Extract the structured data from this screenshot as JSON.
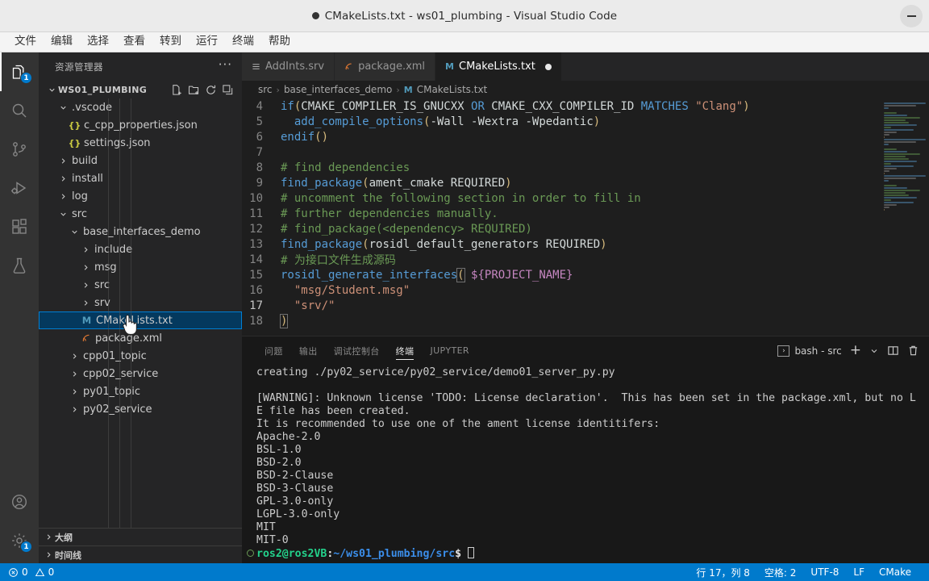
{
  "window": {
    "title": "CMakeLists.txt - ws01_plumbing - Visual Studio Code",
    "dirty_indicator": "●",
    "minimize_label": "–"
  },
  "menubar": {
    "items": [
      {
        "label": "文件",
        "name": "menu-file"
      },
      {
        "label": "编辑",
        "name": "menu-edit"
      },
      {
        "label": "选择",
        "name": "menu-selection"
      },
      {
        "label": "查看",
        "name": "menu-view"
      },
      {
        "label": "转到",
        "name": "menu-go"
      },
      {
        "label": "运行",
        "name": "menu-run"
      },
      {
        "label": "终端",
        "name": "menu-terminal"
      },
      {
        "label": "帮助",
        "name": "menu-help"
      }
    ]
  },
  "activitybar": {
    "items": [
      {
        "icon": "files-explorer-icon",
        "active": true,
        "badge": "1"
      },
      {
        "icon": "search-icon",
        "active": false,
        "badge": ""
      },
      {
        "icon": "source-control-icon",
        "active": false,
        "badge": ""
      },
      {
        "icon": "run-and-debug-icon",
        "active": false,
        "badge": ""
      },
      {
        "icon": "extensions-icon",
        "active": false,
        "badge": ""
      },
      {
        "icon": "testing-flask-icon",
        "active": false,
        "badge": ""
      }
    ],
    "bottom": [
      {
        "icon": "account-icon",
        "badge": ""
      },
      {
        "icon": "settings-gear-icon",
        "badge": "1"
      }
    ]
  },
  "sidebar": {
    "title": "资源管理器",
    "more_actions": "···",
    "root": {
      "label": "WS01_PLUMBING",
      "actions": [
        "new-file-icon",
        "new-folder-icon",
        "refresh-icon",
        "collapse-all-icon"
      ]
    },
    "tree": [
      {
        "label": ".vscode",
        "depth": 1,
        "type": "folder",
        "expanded": true,
        "icon": "chevron-down-icon"
      },
      {
        "label": "c_cpp_properties.json",
        "depth": 2,
        "type": "json",
        "icon": "json-file-icon"
      },
      {
        "label": "settings.json",
        "depth": 2,
        "type": "json",
        "icon": "json-file-icon"
      },
      {
        "label": "build",
        "depth": 1,
        "type": "folder",
        "expanded": false,
        "icon": "chevron-right-icon"
      },
      {
        "label": "install",
        "depth": 1,
        "type": "folder",
        "expanded": false,
        "icon": "chevron-right-icon"
      },
      {
        "label": "log",
        "depth": 1,
        "type": "folder",
        "expanded": false,
        "icon": "chevron-right-icon"
      },
      {
        "label": "src",
        "depth": 1,
        "type": "folder",
        "expanded": true,
        "icon": "chevron-down-icon"
      },
      {
        "label": "base_interfaces_demo",
        "depth": 2,
        "type": "folder",
        "expanded": true,
        "icon": "chevron-down-icon"
      },
      {
        "label": "include",
        "depth": 3,
        "type": "folder",
        "expanded": false,
        "icon": "chevron-right-icon"
      },
      {
        "label": "msg",
        "depth": 3,
        "type": "folder",
        "expanded": false,
        "icon": "chevron-right-icon"
      },
      {
        "label": "src",
        "depth": 3,
        "type": "folder",
        "expanded": false,
        "icon": "chevron-right-icon"
      },
      {
        "label": "srv",
        "depth": 3,
        "type": "folder",
        "expanded": false,
        "icon": "chevron-right-icon"
      },
      {
        "label": "CMakeLists.txt",
        "depth": 3,
        "type": "cmake",
        "selected": true,
        "icon": "cmake-file-icon"
      },
      {
        "label": "package.xml",
        "depth": 3,
        "type": "xml",
        "icon": "xml-file-icon"
      },
      {
        "label": "cpp01_topic",
        "depth": 2,
        "type": "folder",
        "expanded": false,
        "icon": "chevron-right-icon"
      },
      {
        "label": "cpp02_service",
        "depth": 2,
        "type": "folder",
        "expanded": false,
        "icon": "chevron-right-icon"
      },
      {
        "label": "py01_topic",
        "depth": 2,
        "type": "folder",
        "expanded": false,
        "icon": "chevron-right-icon"
      },
      {
        "label": "py02_service",
        "depth": 2,
        "type": "folder",
        "expanded": false,
        "icon": "chevron-right-icon"
      }
    ],
    "collapsed_sections": [
      {
        "label": "大纲",
        "name": "outline-section"
      },
      {
        "label": "时间线",
        "name": "timeline-section"
      }
    ]
  },
  "editor": {
    "tabs": [
      {
        "label": "AddInts.srv",
        "icon": "srv-file-icon",
        "active": false,
        "dirty": false
      },
      {
        "label": "package.xml",
        "icon": "xml-file-icon",
        "active": false,
        "dirty": false
      },
      {
        "label": "CMakeLists.txt",
        "icon": "cmake-file-icon",
        "active": true,
        "dirty": true
      }
    ],
    "breadcrumb": [
      "src",
      "base_interfaces_demo",
      "CMakeLists.txt"
    ],
    "breadcrumb_separator": "›",
    "breadcrumb_file_icon": "cmake-file-icon",
    "active_line": 17,
    "lines": [
      {
        "n": "4",
        "tokens": [
          {
            "t": "if",
            "c": "k-fn"
          },
          {
            "t": "(",
            "c": "k-par"
          },
          {
            "t": "CMAKE_COMPILER_IS_GNUCXX ",
            "c": "k-plain"
          },
          {
            "t": "OR",
            "c": "k-kw"
          },
          {
            "t": " CMAKE_CXX_COMPILER_ID ",
            "c": "k-plain"
          },
          {
            "t": "MATCHES",
            "c": "k-kw"
          },
          {
            "t": " ",
            "c": "k-plain"
          },
          {
            "t": "\"Clang\"",
            "c": "k-str"
          },
          {
            "t": ")",
            "c": "k-par"
          }
        ]
      },
      {
        "n": "5",
        "tokens": [
          {
            "t": "  ",
            "c": "k-plain"
          },
          {
            "t": "add_compile_options",
            "c": "k-fn"
          },
          {
            "t": "(",
            "c": "k-par"
          },
          {
            "t": "-Wall -Wextra -Wpedantic",
            "c": "k-plain"
          },
          {
            "t": ")",
            "c": "k-par"
          }
        ]
      },
      {
        "n": "6",
        "tokens": [
          {
            "t": "endif",
            "c": "k-fn"
          },
          {
            "t": "()",
            "c": "k-par"
          }
        ]
      },
      {
        "n": "7",
        "tokens": []
      },
      {
        "n": "8",
        "tokens": [
          {
            "t": "# find dependencies",
            "c": "k-cmt"
          }
        ]
      },
      {
        "n": "9",
        "tokens": [
          {
            "t": "find_package",
            "c": "k-fn"
          },
          {
            "t": "(",
            "c": "k-par"
          },
          {
            "t": "ament_cmake REQUIRED",
            "c": "k-plain"
          },
          {
            "t": ")",
            "c": "k-par"
          }
        ]
      },
      {
        "n": "10",
        "tokens": [
          {
            "t": "# uncomment the following section in order to fill in",
            "c": "k-cmt"
          }
        ]
      },
      {
        "n": "11",
        "tokens": [
          {
            "t": "# further dependencies manually.",
            "c": "k-cmt"
          }
        ]
      },
      {
        "n": "12",
        "tokens": [
          {
            "t": "# find_package(<dependency> REQUIRED)",
            "c": "k-cmt"
          }
        ]
      },
      {
        "n": "13",
        "tokens": [
          {
            "t": "find_package",
            "c": "k-fn"
          },
          {
            "t": "(",
            "c": "k-par"
          },
          {
            "t": "rosidl_default_generators REQUIRED",
            "c": "k-plain"
          },
          {
            "t": ")",
            "c": "k-par"
          }
        ]
      },
      {
        "n": "14",
        "tokens": [
          {
            "t": "# 为接口文件生成源码",
            "c": "k-cmt"
          }
        ]
      },
      {
        "n": "15",
        "tokens": [
          {
            "t": "rosidl_generate_interfaces",
            "c": "k-fn"
          },
          {
            "t": "(",
            "c": "k-par",
            "box": true
          },
          {
            "t": " ",
            "c": "k-plain"
          },
          {
            "t": "${PROJECT_NAME}",
            "c": "k-pink"
          }
        ]
      },
      {
        "n": "16",
        "tokens": [
          {
            "t": "  ",
            "c": "k-plain"
          },
          {
            "t": "\"msg/Student.msg\"",
            "c": "k-str"
          }
        ]
      },
      {
        "n": "17",
        "tokens": [
          {
            "t": "  ",
            "c": "k-plain"
          },
          {
            "t": "\"srv/\"",
            "c": "k-str"
          }
        ]
      },
      {
        "n": "18",
        "tokens": [
          {
            "t": ")",
            "c": "k-par",
            "box": true
          }
        ]
      }
    ]
  },
  "panel": {
    "tabs": [
      {
        "label": "问题",
        "active": false
      },
      {
        "label": "输出",
        "active": false
      },
      {
        "label": "调试控制台",
        "active": false
      },
      {
        "label": "终端",
        "active": true
      },
      {
        "label": "JUPYTER",
        "active": false
      }
    ],
    "terminal_selector": "bash - src",
    "actions": [
      {
        "icon": "terminal-icon"
      },
      {
        "icon": "new-terminal-plus-icon"
      },
      {
        "icon": "chevron-down-icon"
      },
      {
        "icon": "split-terminal-icon"
      },
      {
        "icon": "trash-icon"
      }
    ],
    "terminal_lines": [
      {
        "text": "creating ./py02_service/py02_service/demo01_server_py.py"
      },
      {
        "text": ""
      },
      {
        "text": "[WARNING]: Unknown license 'TODO: License declaration'.  This has been set in the package.xml, but no L"
      },
      {
        "text": "E file has been created."
      },
      {
        "text": "It is recommended to use one of the ament license identitifers:"
      },
      {
        "text": "Apache-2.0"
      },
      {
        "text": "BSL-1.0"
      },
      {
        "text": "BSD-2.0"
      },
      {
        "text": "BSD-2-Clause"
      },
      {
        "text": "BSD-3-Clause"
      },
      {
        "text": "GPL-3.0-only"
      },
      {
        "text": "LGPL-3.0-only"
      },
      {
        "text": "MIT"
      },
      {
        "text": "MIT-0"
      }
    ],
    "prompt": {
      "user_host": "ros2@ros2VB",
      "colon": ":",
      "path": "~/ws01_plumbing/src",
      "symbol": "$"
    }
  },
  "statusbar": {
    "errors_icon": "error-circle-icon",
    "errors": "0",
    "warnings_icon": "warning-triangle-icon",
    "warnings": "0",
    "right_items": [
      {
        "label": "行 17，列 8",
        "name": "cursor-position"
      },
      {
        "label": "空格: 2",
        "name": "indentation"
      },
      {
        "label": "UTF-8",
        "name": "encoding"
      },
      {
        "label": "LF",
        "name": "eol"
      },
      {
        "label": "CMake",
        "name": "language-mode"
      }
    ]
  },
  "colors": {
    "accent": "#007acc",
    "editor_bg": "#1e1e1e",
    "sidebar_bg": "#252526",
    "activitybar_bg": "#333333",
    "panel_bg": "#181818",
    "titlebar_bg": "#ebebeb",
    "selected_row_bg": "#04395e",
    "selected_row_border": "#007fd4"
  }
}
